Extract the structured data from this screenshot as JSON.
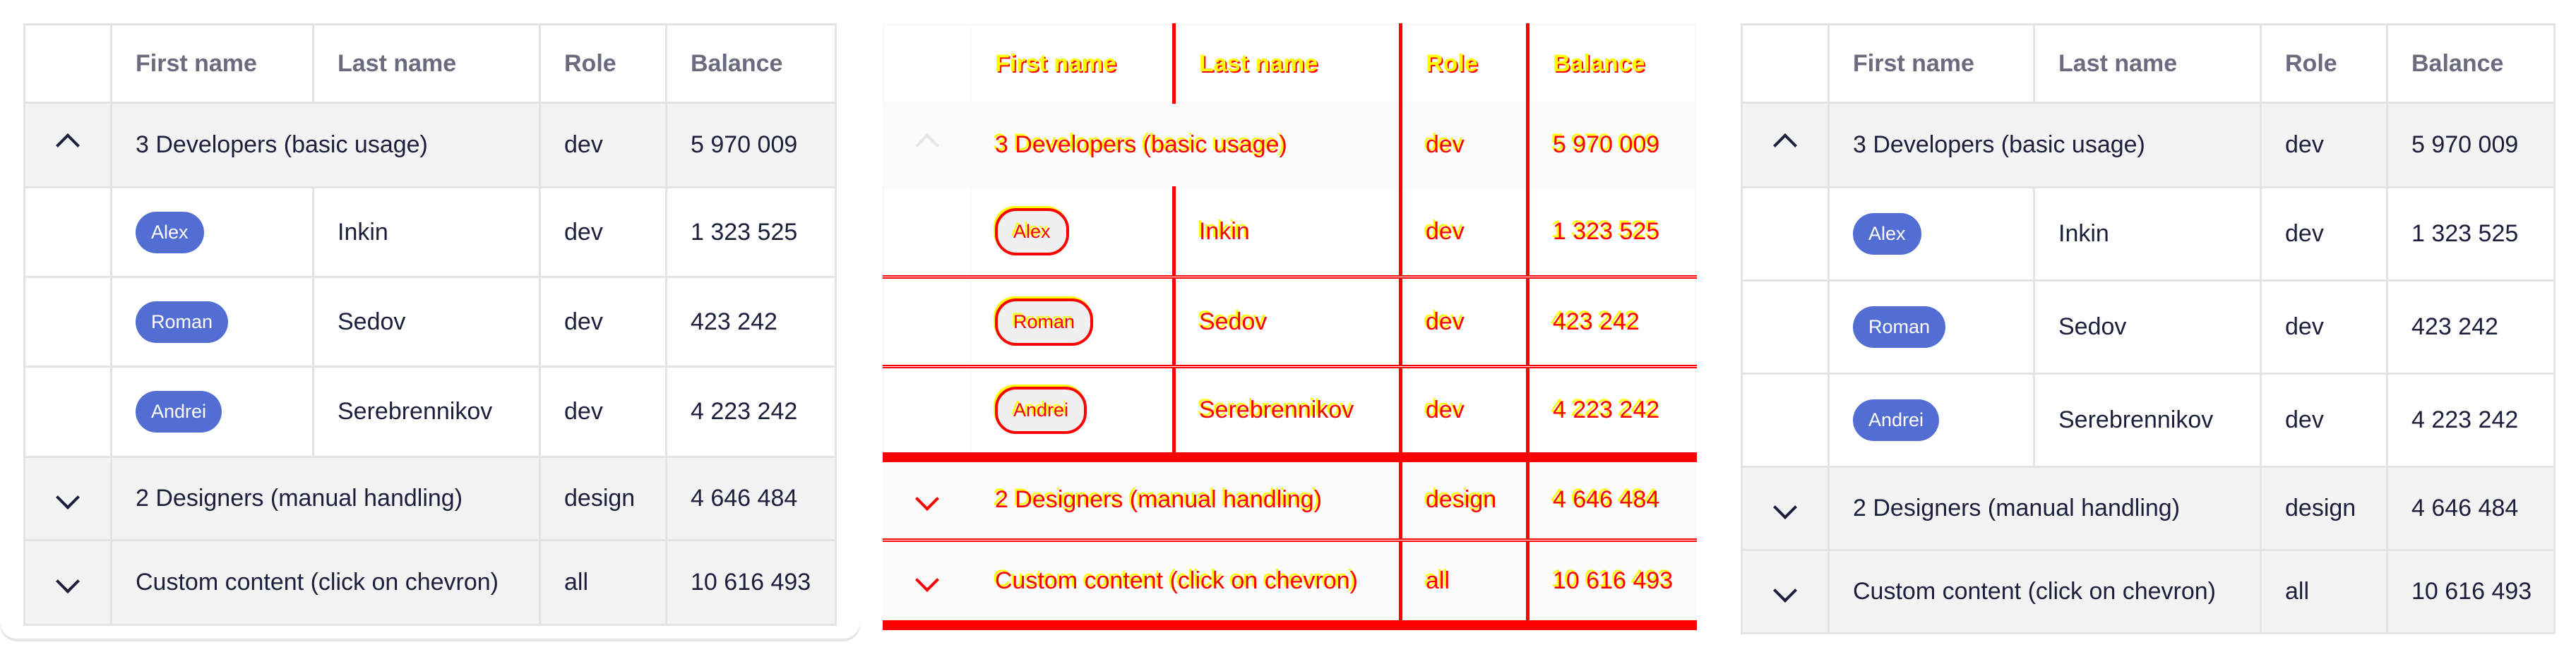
{
  "headers": [
    "First name",
    "Last name",
    "Role",
    "Balance"
  ],
  "rows": [
    {
      "type": "group",
      "expanded": true,
      "label": "3 Developers (basic usage)",
      "role": "dev",
      "balance": "5 970 009"
    },
    {
      "type": "item",
      "first": "Alex",
      "last": "Inkin",
      "role": "dev",
      "balance": "1 323 525"
    },
    {
      "type": "item",
      "first": "Roman",
      "last": "Sedov",
      "role": "dev",
      "balance": "423 242"
    },
    {
      "type": "item",
      "first": "Andrei",
      "last": "Serebrennikov",
      "role": "dev",
      "balance": "4 223 242"
    },
    {
      "type": "group",
      "expanded": false,
      "label": "2 Designers (manual handling)",
      "role": "design",
      "balance": "4 646 484"
    },
    {
      "type": "group",
      "expanded": false,
      "label": "Custom content (click on chevron)",
      "role": "all",
      "balance": "10 616 493"
    }
  ],
  "colors": {
    "chip": "#526ed3",
    "group_bg": "#f3f3f3",
    "diff_red": "#ff0000",
    "diff_yellow": "#ffff00"
  }
}
